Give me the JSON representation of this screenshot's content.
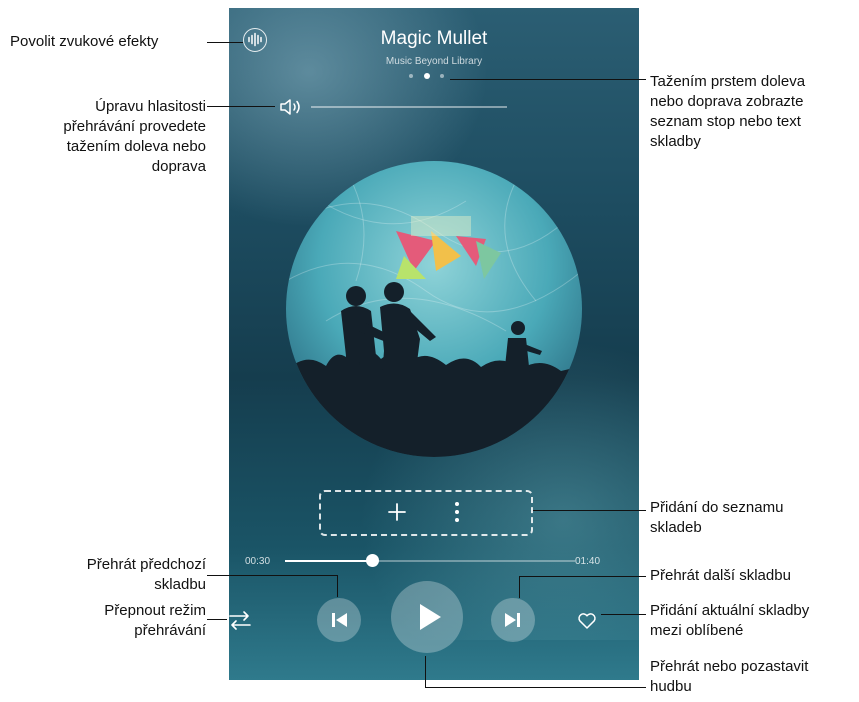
{
  "player": {
    "title": "Magic Mullet",
    "artist": "Music Beyond Library",
    "time_current": "00:30",
    "time_total": "01:40",
    "progress": 0.3,
    "volume": 1.0,
    "page_index": 1,
    "page_count": 3,
    "icons": {
      "sound_effects": "sound-effects-icon",
      "volume": "speaker-icon",
      "add": "plus-icon",
      "more": "more-vertical-icon",
      "shuffle": "repeat-mode-icon",
      "previous": "skip-previous-icon",
      "play": "play-icon",
      "next": "skip-next-icon",
      "favorite": "heart-icon"
    }
  },
  "annotations": {
    "sound_effects": "Povolit zvukové efekty",
    "volume": [
      "Úpravu hlasitosti",
      "přehrávání provedete",
      "tažením doleva nebo",
      "doprava"
    ],
    "swipe": [
      "Tažením prstem doleva",
      "nebo doprava zobrazte",
      "seznam stop nebo text",
      "skladby"
    ],
    "add_to_playlist": [
      "Přidání do seznamu",
      "skladeb"
    ],
    "previous": [
      "Přehrát předchozí",
      "skladbu"
    ],
    "next": "Přehrát další skladbu",
    "play_mode": [
      "Přepnout režim",
      "přehrávání"
    ],
    "favorite": [
      "Přidání aktuální skladby",
      "mezi oblíbené"
    ],
    "play_pause": [
      "Přehrát nebo pozastavit",
      "hudbu"
    ]
  },
  "colors": {
    "background_top": "#2b5e73",
    "background_bottom": "#2f7a8c",
    "annotation_text": "#111111"
  }
}
